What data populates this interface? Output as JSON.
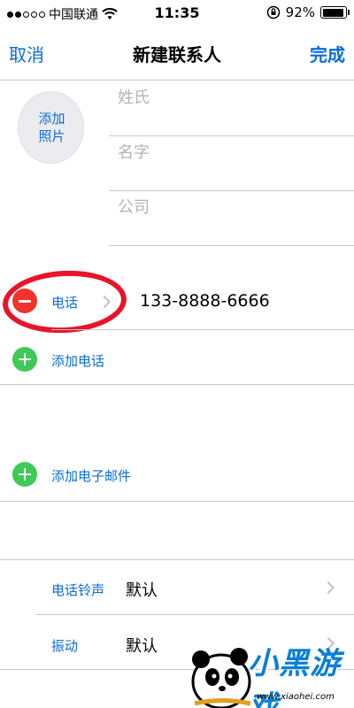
{
  "status_bar": {
    "carrier": "中国联通",
    "time": "11:35",
    "battery": "92%",
    "battery_level": 0.92,
    "signal_strength": 2,
    "signal_max": 5
  },
  "nav": {
    "cancel_label": "取消",
    "title": "新建联系人",
    "done_label": "完成"
  },
  "photo": {
    "label": "添加照片",
    "label_line1": "添加",
    "label_line2": "照片"
  },
  "name_fields": [
    {
      "placeholder": "姓氏",
      "value": ""
    },
    {
      "placeholder": "名字",
      "value": ""
    },
    {
      "placeholder": "公司",
      "value": ""
    }
  ],
  "phone": {
    "label": "电话",
    "number": "133-8888-6666"
  },
  "actions": {
    "add_phone": "添加电话",
    "add_email": "添加电子邮件"
  },
  "settings": [
    {
      "label": "电话铃声",
      "value": "默认"
    },
    {
      "label": "振动",
      "value": "默认"
    }
  ],
  "watermark": {
    "text": "小黑游戏",
    "url": "www.xiaohei.com"
  },
  "colors": {
    "accent": "#0a6cd8",
    "delete": "#f0332c",
    "add": "#3fc955",
    "highlight": "#e8142a",
    "separator": "#c8c7cc"
  }
}
